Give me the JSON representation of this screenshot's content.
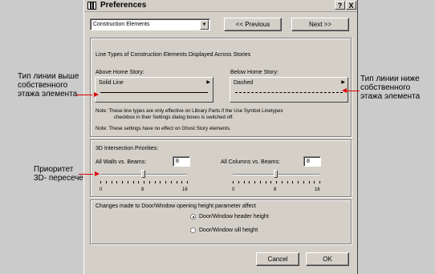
{
  "window": {
    "title": "Preferences",
    "title_buttons": [
      "?",
      "X"
    ]
  },
  "toolbar": {
    "category_select": "Construction Elements",
    "prev_button": "<< Previous",
    "next_button": "Next >>"
  },
  "line_types": {
    "heading": "Line Types of Construction Elements Displayed Across Stories",
    "above_label": "Above Home Story:",
    "above_value": "Solid Line",
    "below_label": "Below Home Story:",
    "below_value": "Dashed",
    "note1": "Note:   These line types are only effective on Library Parts if the Use Symbol Linetypes",
    "note1b": "checkbox in their Settings dialog boxes is switched off.",
    "note2": "Note:   These settings have no effect on Ghost Story elements."
  },
  "intersection": {
    "heading": "3D Intersection Priorities:",
    "walls_label": "All Walls vs. Beams:",
    "walls_value": "8",
    "columns_label": "All Columns vs. Beams:",
    "columns_value": "8",
    "ticks": [
      "0",
      "8",
      "16"
    ]
  },
  "door_window": {
    "heading": "Changes made to Door/Window opening height parameter affect",
    "option_header": "Door/Window header height",
    "option_sill": "Door/Window sill height",
    "selected": "Door/Window header height"
  },
  "footer": {
    "cancel": "Cancel",
    "ok": "OK"
  },
  "annotations": {
    "left_top": [
      "Тип линии выше",
      "собственного",
      "этажа элемента"
    ],
    "right_top": [
      "Тип линии ниже",
      "собственного",
      "этажа элемента"
    ],
    "left_mid": [
      "Приоритет",
      "3D- пересечений"
    ]
  },
  "colors": {
    "arrow": "#e00000",
    "dialog_face": "#d4d0c8"
  }
}
